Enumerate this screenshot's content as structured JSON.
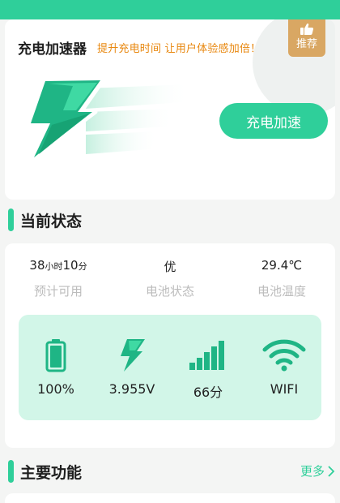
{
  "hero": {
    "title": "充电加速器",
    "subtitle": "提升充电时间 让用户体验感加倍！",
    "badge": "推荐",
    "cta": "充电加速"
  },
  "current_status": {
    "title": "当前状态",
    "stats": [
      {
        "value_main": "38",
        "value_unit1": "小时",
        "value_min": "10",
        "value_unit2": "分",
        "label": "预计可用"
      },
      {
        "value": "优",
        "label": "电池状态"
      },
      {
        "value": "29.4℃",
        "label": "电池温度"
      }
    ],
    "metrics": [
      {
        "icon": "battery-icon",
        "value": "100%"
      },
      {
        "icon": "lightning-icon",
        "value": "3.955V"
      },
      {
        "icon": "signal-bars-icon",
        "value": "66分"
      },
      {
        "icon": "wifi-icon",
        "value": "WIFI"
      }
    ]
  },
  "main_functions": {
    "title": "主要功能",
    "more": "更多"
  },
  "colors": {
    "accent": "#2fcf9a",
    "metrics_bg": "#d2f6e8",
    "subtitle": "#e8870e",
    "badge": "#d9a763"
  }
}
